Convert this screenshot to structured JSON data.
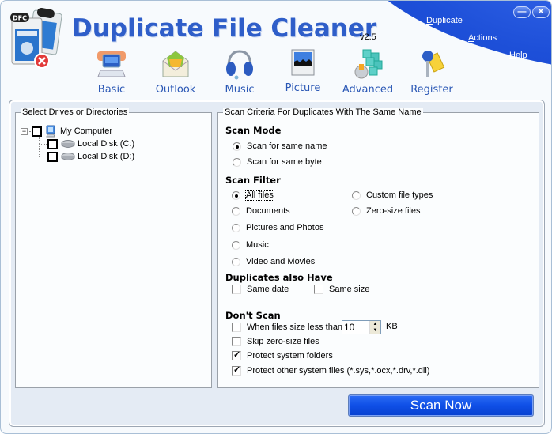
{
  "app": {
    "title": "Duplicate File Cleaner",
    "version": "v2.5",
    "logo_text": "DFC"
  },
  "top_menu": [
    {
      "label": "Duplicate",
      "mnemonic": "D"
    },
    {
      "label": "Actions",
      "mnemonic": "A"
    },
    {
      "label": "Help",
      "mnemonic": "H"
    }
  ],
  "window_controls": {
    "minimize": "—",
    "close": "✕"
  },
  "toolbar": [
    {
      "label": "Basic",
      "icon": "computer-icon"
    },
    {
      "label": "Outlook",
      "icon": "envelope-icon"
    },
    {
      "label": "Music",
      "icon": "headphones-icon"
    },
    {
      "label": "Picture",
      "icon": "picture-icon"
    },
    {
      "label": "Advanced",
      "icon": "cubes-gear-icon"
    },
    {
      "label": "Register",
      "icon": "key-icon"
    }
  ],
  "left_panel": {
    "title": "Select Drives or Directories",
    "tree": {
      "root": {
        "label": "My Computer",
        "expanded": true,
        "checked": false
      },
      "children": [
        {
          "label": "Local Disk (C:)",
          "checked": false
        },
        {
          "label": "Local Disk (D:)",
          "checked": false
        }
      ]
    }
  },
  "right_panel": {
    "title": "Scan Criteria For Duplicates With The Same Name",
    "scan_mode": {
      "title": "Scan Mode",
      "options": [
        {
          "label": "Scan for same name",
          "selected": true
        },
        {
          "label": "Scan for same byte",
          "selected": false
        }
      ]
    },
    "scan_filter": {
      "title": "Scan Filter",
      "options": [
        {
          "label": "All files",
          "selected": true
        },
        {
          "label": "Documents",
          "selected": false
        },
        {
          "label": "Pictures and Photos",
          "selected": false
        },
        {
          "label": "Music",
          "selected": false
        },
        {
          "label": "Video and Movies",
          "selected": false
        },
        {
          "label": "Custom file types",
          "selected": false
        },
        {
          "label": "Zero-size files",
          "selected": false
        }
      ]
    },
    "duplicates_also_have": {
      "title": "Duplicates also Have",
      "options": [
        {
          "label": "Same date",
          "checked": false
        },
        {
          "label": "Same size",
          "checked": false
        }
      ]
    },
    "dont_scan": {
      "title": "Don't Scan",
      "options": [
        {
          "label": "When files size less than",
          "checked": false
        },
        {
          "label": "Skip zero-size files",
          "checked": false
        },
        {
          "label": "Protect system folders",
          "checked": true
        },
        {
          "label": "Protect other system files (*.sys,*.ocx,*.drv,*.dll)",
          "checked": true
        }
      ],
      "size_value": "10",
      "size_unit": "KB"
    }
  },
  "scan_button": {
    "label": "Scan Now"
  },
  "colors": {
    "brand_blue": "#2f5ec9",
    "header_swoosh": "#1d4fd8",
    "scan_button": "#0f4fe6"
  }
}
